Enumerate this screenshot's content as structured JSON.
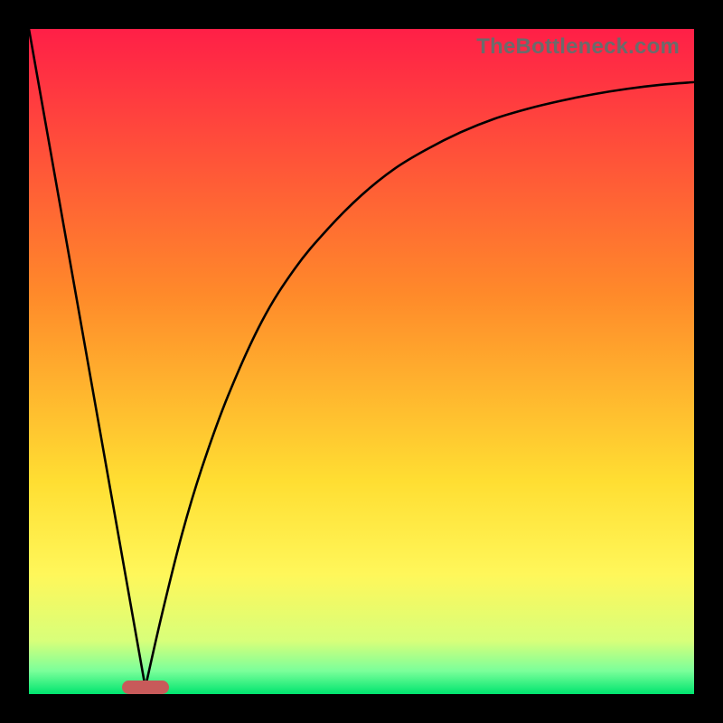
{
  "watermark": "TheBottleneck.com",
  "chart_data": {
    "type": "line",
    "title": "",
    "xlabel": "",
    "ylabel": "",
    "xlim": [
      0,
      100
    ],
    "ylim": [
      0,
      100
    ],
    "grid": false,
    "legend": false,
    "background_gradient": {
      "stops": [
        {
          "pos": 0.0,
          "color": "#ff1f47"
        },
        {
          "pos": 0.4,
          "color": "#ff8a2a"
        },
        {
          "pos": 0.68,
          "color": "#ffde32"
        },
        {
          "pos": 0.82,
          "color": "#fff75a"
        },
        {
          "pos": 0.92,
          "color": "#d8ff7a"
        },
        {
          "pos": 0.965,
          "color": "#7bff9a"
        },
        {
          "pos": 1.0,
          "color": "#00e56f"
        }
      ]
    },
    "marker": {
      "x_start": 14,
      "x_end": 21,
      "y_start": 98,
      "y_end": 100,
      "color": "#c85a5a"
    },
    "series": [
      {
        "name": "left-line",
        "x": [
          0,
          17.5
        ],
        "y": [
          100,
          1
        ]
      },
      {
        "name": "right-curve",
        "x": [
          17.5,
          20,
          23,
          26,
          30,
          35,
          40,
          45,
          50,
          55,
          60,
          65,
          70,
          75,
          80,
          85,
          90,
          95,
          100
        ],
        "y": [
          1,
          12,
          24,
          34,
          45,
          56,
          64,
          70,
          75,
          79,
          82,
          84.5,
          86.5,
          88,
          89.2,
          90.2,
          91,
          91.6,
          92
        ]
      }
    ]
  }
}
